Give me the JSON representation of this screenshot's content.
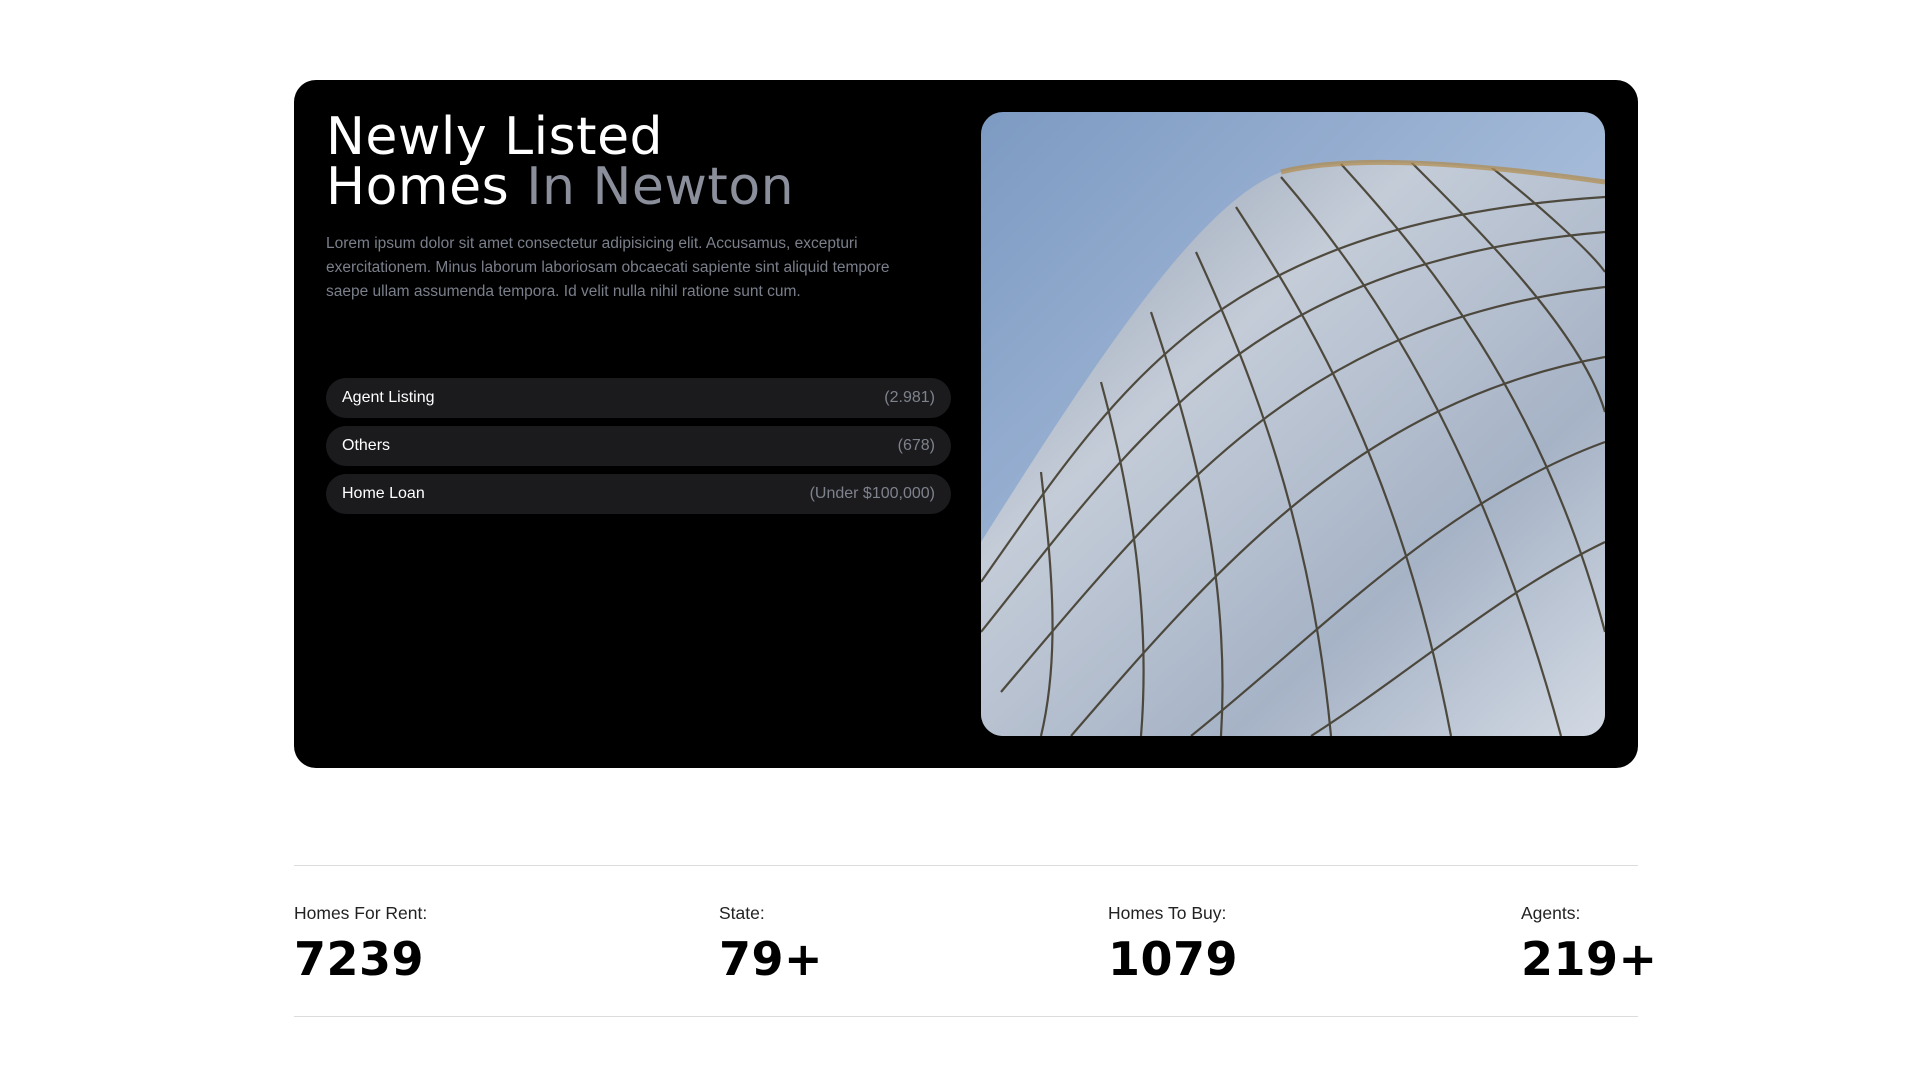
{
  "hero": {
    "title_line1": "Newly Listed",
    "title_line2": "Homes",
    "title_accent": "In Newton",
    "description": "Lorem ipsum dolor sit amet consectetur adipisicing elit. Accusamus, excepturi exercitationem. Minus laborum laboriosam obcaecati sapiente sint aliquid tempore saepe ullam assumenda tempora. Id velit nulla nihil ratione sunt cum.",
    "accent_color": "#8b8f9c",
    "pills": [
      {
        "label": "Agent Listing",
        "count": "(2.981)"
      },
      {
        "label": "Others",
        "count": "(678)"
      },
      {
        "label": "Home Loan",
        "count": "(Under $100,000)"
      }
    ],
    "image": "glass-building-facade-photo"
  },
  "stats": [
    {
      "label": "Homes For Rent:",
      "value": "7239"
    },
    {
      "label": "State:",
      "value": "79+"
    },
    {
      "label": "Homes To Buy:",
      "value": "1079"
    },
    {
      "label": "Agents:",
      "value": "219+"
    }
  ]
}
